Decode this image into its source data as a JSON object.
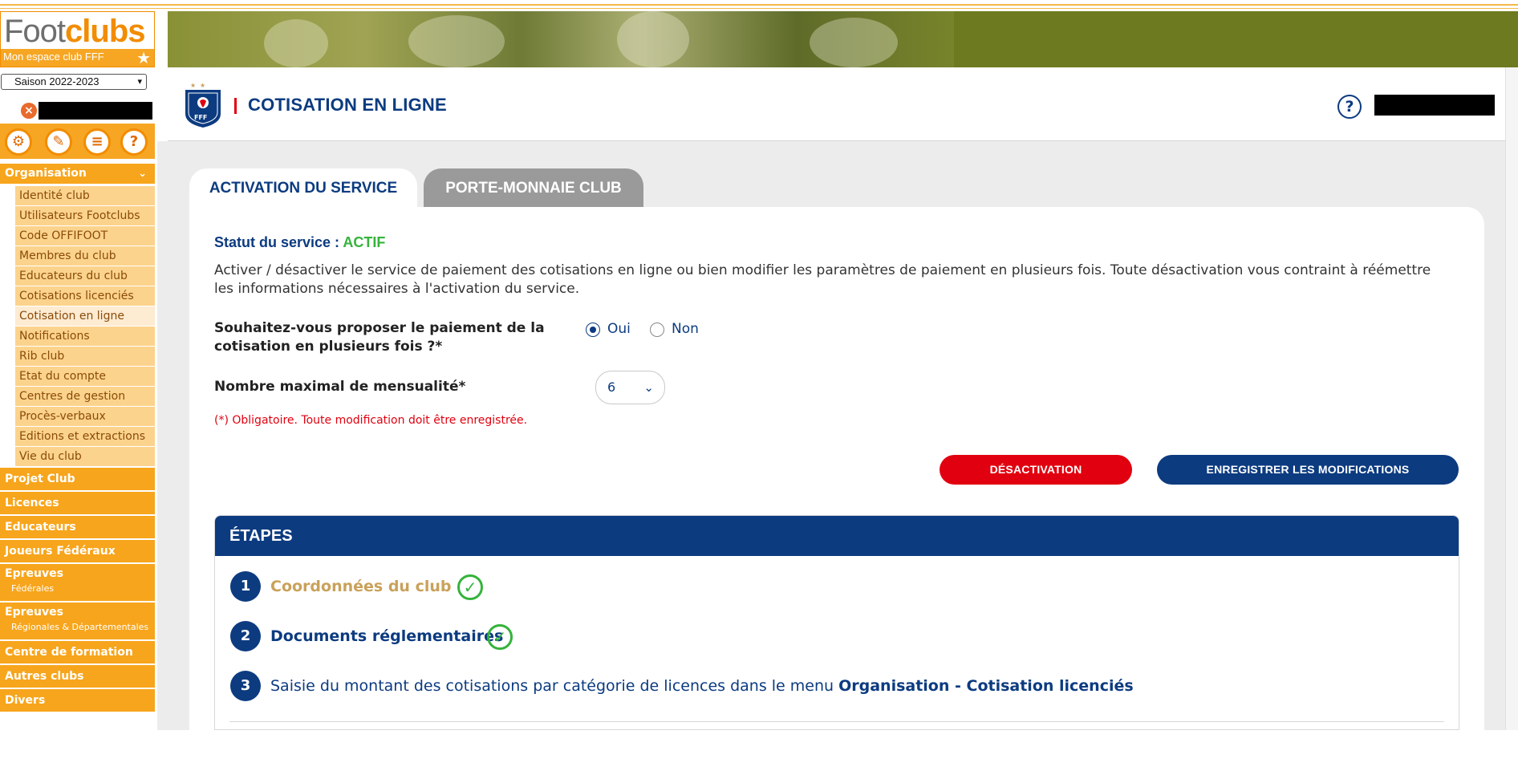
{
  "sidebar": {
    "logo_foot": "Foot",
    "logo_clubs": "clubs",
    "logo_tagline": "Mon espace club FFF",
    "season": "Saison 2022-2023",
    "menu": {
      "organisation": "Organisation",
      "organisation_items": [
        "Identité club",
        "Utilisateurs Footclubs",
        "Code OFFIFOOT",
        "Membres du club",
        "Educateurs du club",
        "Cotisations licenciés",
        "Cotisation en ligne",
        "Notifications",
        "Rib club",
        "Etat du compte",
        "Centres de gestion",
        "Procès-verbaux",
        "Editions et extractions",
        "Vie du club"
      ],
      "projet_club": "Projet Club",
      "licences": "Licences",
      "educateurs": "Educateurs",
      "joueurs_federaux": "Joueurs Fédéraux",
      "epreuves_fed": "Epreuves",
      "epreuves_fed_sub": "Fédérales",
      "epreuves_reg": "Epreuves",
      "epreuves_reg_sub": "Régionales & Départementales",
      "centre_formation": "Centre de formation",
      "autres_clubs": "Autres clubs",
      "divers": "Divers"
    }
  },
  "header": {
    "title": "COTISATION EN LIGNE",
    "help": "?"
  },
  "tabs": {
    "activation": "ACTIVATION DU SERVICE",
    "porte_monnaie": "PORTE-MONNAIE CLUB"
  },
  "form": {
    "status_label": "Statut du service : ",
    "status_value": "ACTIF",
    "description": "Activer / désactiver le service de paiement des cotisations en ligne ou bien modifier les paramètres de paiement en plusieurs fois. Toute désactivation vous contraint à réémettre les informations nécessaires à l'activation du service.",
    "question": "Souhaitez-vous proposer le paiement de la cotisation en plusieurs fois ?*",
    "radio_yes": "Oui",
    "radio_no": "Non",
    "mensualite_label": "Nombre maximal de mensualité*",
    "mensualite_value": "6",
    "mandatory_note": "(*) Obligatoire. Toute modification doit être enregistrée.",
    "btn_deactivate": "DÉSACTIVATION",
    "btn_save": "ENREGISTRER LES MODIFICATIONS"
  },
  "etapes": {
    "title": "ÉTAPES",
    "steps": [
      {
        "num": "1",
        "text": "Coordonnées du club",
        "done": true
      },
      {
        "num": "2",
        "text": "Documents réglementaires",
        "done": true
      },
      {
        "num": "3",
        "text": "Saisie du montant des cotisations par catégorie de licences dans le menu ",
        "link": "Organisation - Cotisation licenciés"
      }
    ]
  },
  "colors": {
    "navy": "#0c3b80",
    "orange": "#f7a51c",
    "red": "#e1000f",
    "green": "#35b33b"
  }
}
